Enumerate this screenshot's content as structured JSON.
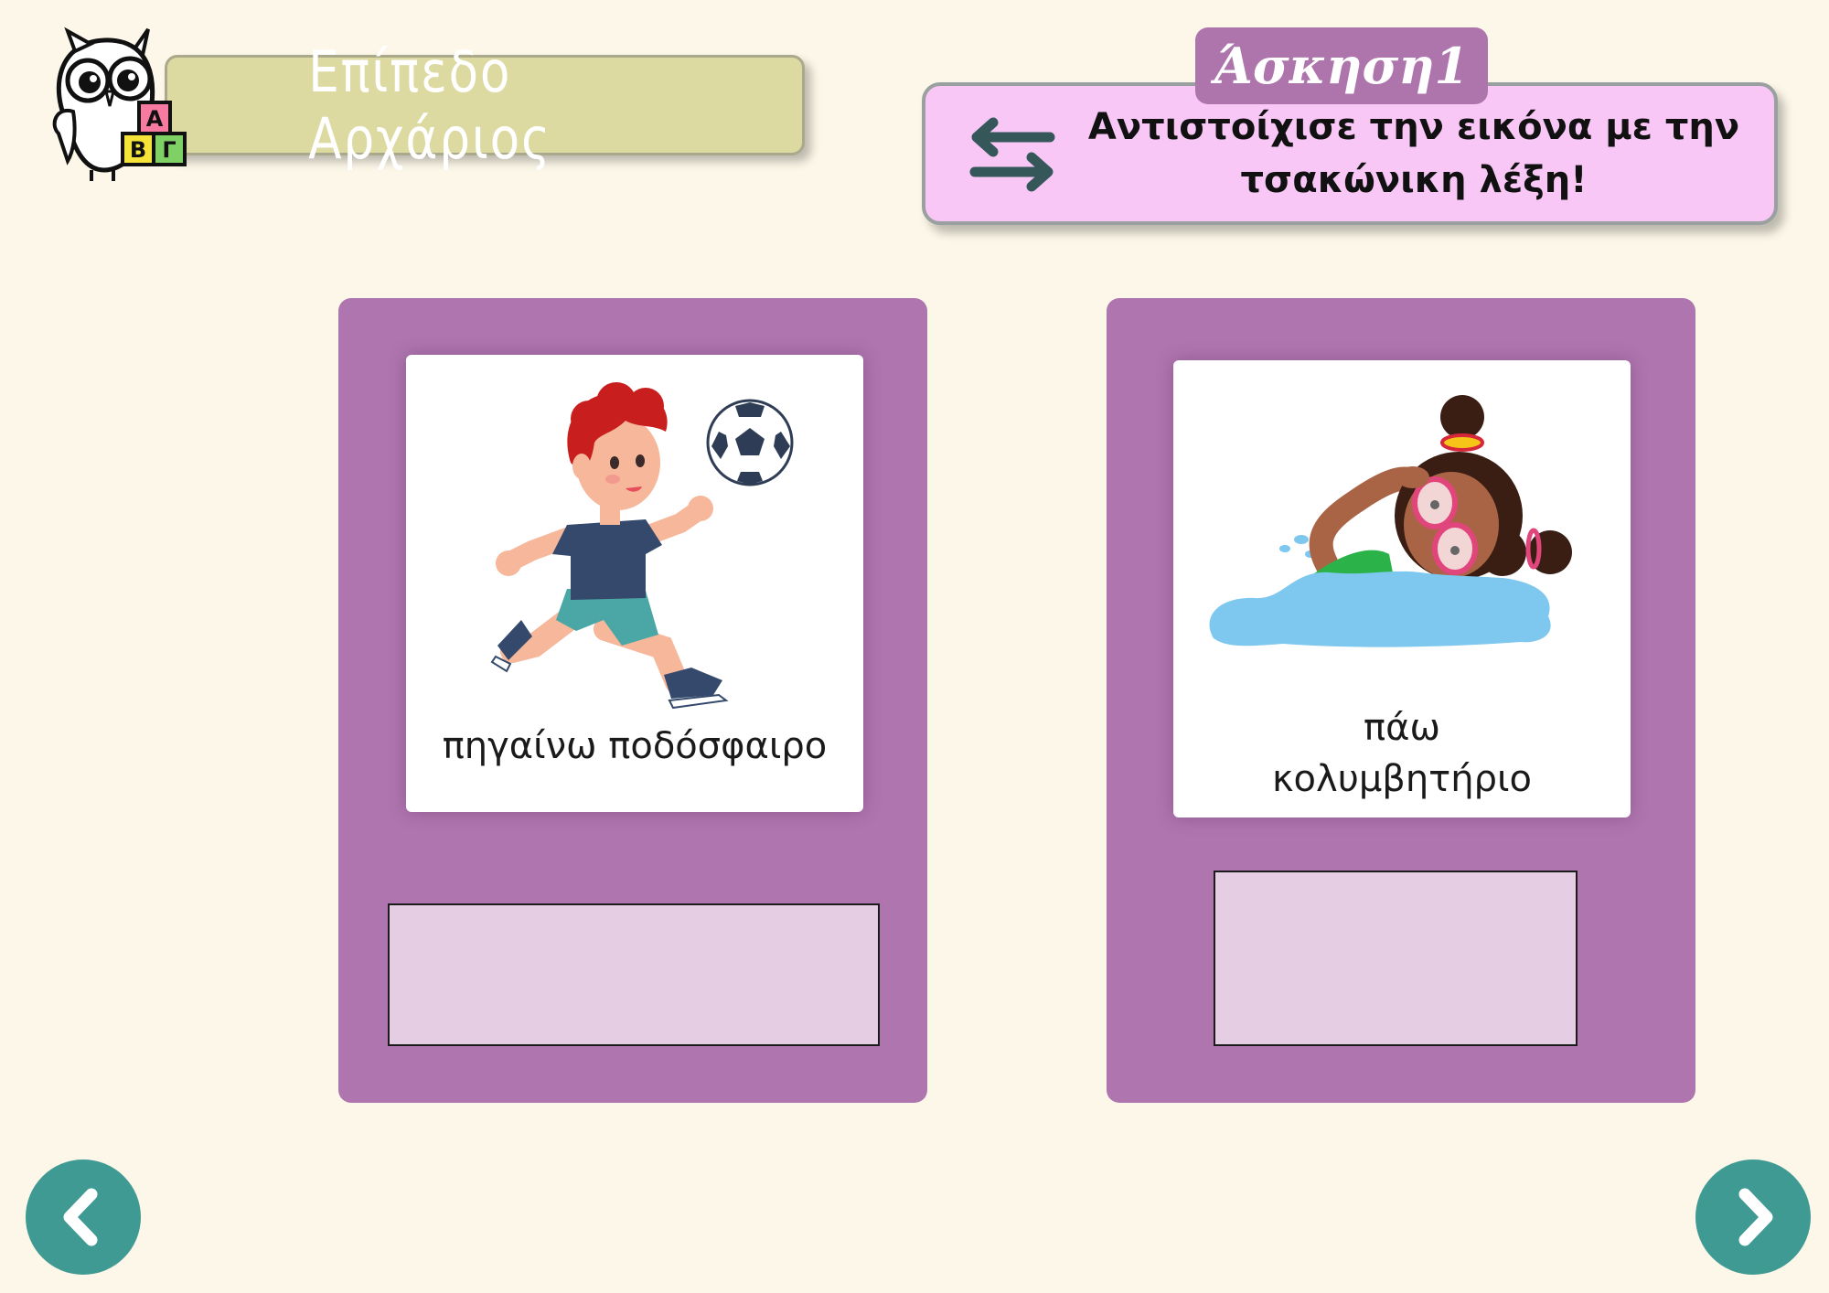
{
  "header": {
    "level_label": "Επίπεδο Αρχάριος",
    "logo_blocks": [
      "A",
      "B",
      "Γ"
    ]
  },
  "exercise": {
    "tag": "Άσκηση1",
    "instruction": "Αντιστοίχισε την εικόνα με την τσακώνικη λέξη!",
    "instruction_icon": "swap-arrows-icon"
  },
  "cards": [
    {
      "illustration": "boy-playing-football",
      "word": "πηγαίνω ποδόσφαιρο",
      "answer_value": ""
    },
    {
      "illustration": "girl-swimming",
      "word_line1": "πάω",
      "word_line2": "κολυμβητήριο",
      "answer_value": ""
    }
  ],
  "navigation": {
    "prev_icon": "chevron-left-icon",
    "next_icon": "chevron-right-icon"
  },
  "colors": {
    "background": "#fcf7e8",
    "card": "#ae75ae",
    "slot": "#e5cde3",
    "nav": "#3f9a93",
    "level_banner": "#dcd9a1",
    "instruction_box": "#f8c7f6"
  }
}
